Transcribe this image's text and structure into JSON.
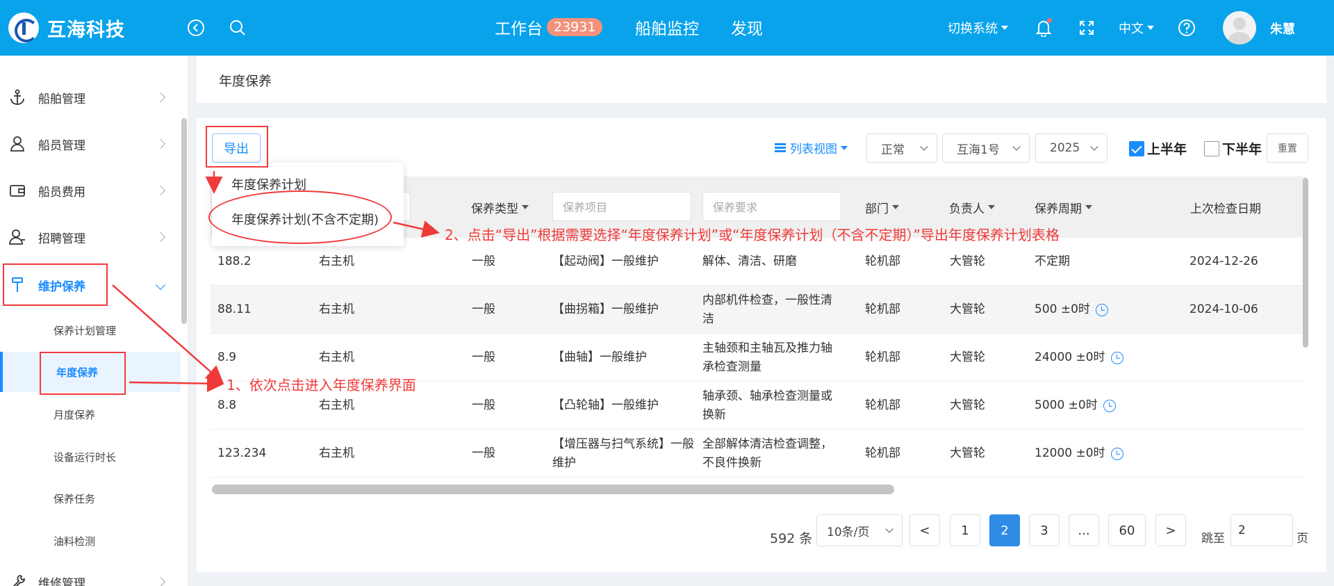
{
  "header": {
    "logo_text": "互海科技",
    "nav": [
      {
        "label": "工作台",
        "badge": "23931"
      },
      {
        "label": "船舶监控"
      },
      {
        "label": "发现"
      }
    ],
    "switch_system": "切换系统",
    "language": "中文",
    "user_name": "朱慧"
  },
  "sidebar": {
    "items": [
      {
        "label": "船舶管理"
      },
      {
        "label": "船员管理"
      },
      {
        "label": "船员费用"
      },
      {
        "label": "招聘管理"
      },
      {
        "label": "维护保养"
      },
      {
        "label": "维修管理"
      }
    ],
    "sub_items": [
      {
        "label": "保养计划管理"
      },
      {
        "label": "年度保养"
      },
      {
        "label": "月度保养"
      },
      {
        "label": "设备运行时长"
      },
      {
        "label": "保养任务"
      },
      {
        "label": "油料检测"
      }
    ]
  },
  "breadcrumb": "年度保养",
  "toolbar": {
    "export_label": "导出",
    "export_menu": [
      "年度保养计划",
      "年度保养计划(不含不定期)"
    ],
    "view_label": "列表视图",
    "status_select": "正常",
    "ship_select": "互海1号",
    "year_select": "2025",
    "first_half": "上半年",
    "second_half": "下半年",
    "reset_label": "重置"
  },
  "table": {
    "headers": {
      "type": "保养类型",
      "item_placeholder": "保养项目",
      "req_placeholder": "保养要求",
      "dept": "部门",
      "owner": "负责人",
      "cycle": "保养周期",
      "last_check": "上次检查日期"
    },
    "rows": [
      {
        "code": "188.2",
        "equip": "右主机",
        "type": "一般",
        "item": "【起动阀】一般维护",
        "req": "解体、清洁、研磨",
        "dept": "轮机部",
        "owner": "大管轮",
        "cycle": "不定期",
        "last": "2024-12-26"
      },
      {
        "code": "88.11",
        "equip": "右主机",
        "type": "一般",
        "item": "【曲拐箱】一般维护",
        "req": "内部机件检查，一般性清洁",
        "dept": "轮机部",
        "owner": "大管轮",
        "cycle": "500 ±0时",
        "last": "2024-10-06"
      },
      {
        "code": "8.9",
        "equip": "右主机",
        "type": "一般",
        "item": "【曲轴】一般维护",
        "req": "主轴颈和主轴瓦及推力轴承检查测量",
        "dept": "轮机部",
        "owner": "大管轮",
        "cycle": "24000 ±0时",
        "last": ""
      },
      {
        "code": "8.8",
        "equip": "右主机",
        "type": "一般",
        "item": "【凸轮轴】一般维护",
        "req": "轴承颈、轴承检查测量或换新",
        "dept": "轮机部",
        "owner": "大管轮",
        "cycle": "5000 ±0时",
        "last": ""
      },
      {
        "code": "123.234",
        "equip": "右主机",
        "type": "一般",
        "item": "【增压器与扫气系统】一般维护",
        "req": "全部解体清洁检查调整，不良件换新",
        "dept": "轮机部",
        "owner": "大管轮",
        "cycle": "12000 ±0时",
        "last": ""
      }
    ]
  },
  "pagination": {
    "total": "592 条",
    "page_size": "10条/页",
    "prev": "<",
    "pages": [
      "1",
      "2",
      "3",
      "...",
      "60"
    ],
    "current_page": "2",
    "next": ">",
    "jump_label": "跳至",
    "jump_value": "2",
    "page_suffix": "页"
  },
  "annotations": {
    "step1": "1、依次点击进入年度保养界面",
    "step2": "2、点击“导出”根据需要选择“年度保养计划”或“年度保养计划（不含不定期）”导出年度保养计划表格"
  },
  "colors": {
    "header_bg": "#09a3ec",
    "accent": "#1a8cff",
    "annotation": "#f03a3a"
  }
}
